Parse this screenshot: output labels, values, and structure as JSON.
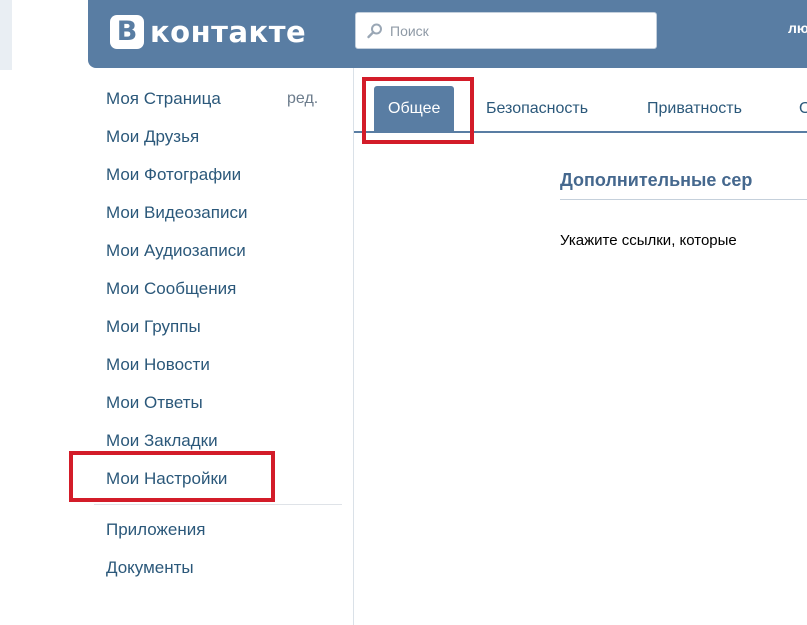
{
  "header": {
    "logo_letter": "В",
    "logo_text": "контакте",
    "search_placeholder": "Поиск",
    "right_text": "лю"
  },
  "sidebar": {
    "items": [
      {
        "label": "Моя Страница",
        "edit": "ред."
      },
      {
        "label": "Мои Друзья"
      },
      {
        "label": "Мои Фотографии"
      },
      {
        "label": "Мои Видеозаписи"
      },
      {
        "label": "Мои Аудиозаписи"
      },
      {
        "label": "Мои Сообщения"
      },
      {
        "label": "Мои Группы"
      },
      {
        "label": "Мои Новости"
      },
      {
        "label": "Мои Ответы"
      },
      {
        "label": "Мои Закладки"
      },
      {
        "label": "Мои Настройки"
      }
    ],
    "extra": [
      {
        "label": "Приложения"
      },
      {
        "label": "Документы"
      }
    ]
  },
  "tabs": [
    {
      "label": "Общее"
    },
    {
      "label": "Безопасность"
    },
    {
      "label": "Приватность"
    },
    {
      "label": "О"
    }
  ],
  "content": {
    "section_title": "Дополнительные сер",
    "section_text": "Укажите ссылки, которые"
  },
  "colors": {
    "brand": "#597da3",
    "link": "#2b587a",
    "highlight": "#d31c29"
  }
}
